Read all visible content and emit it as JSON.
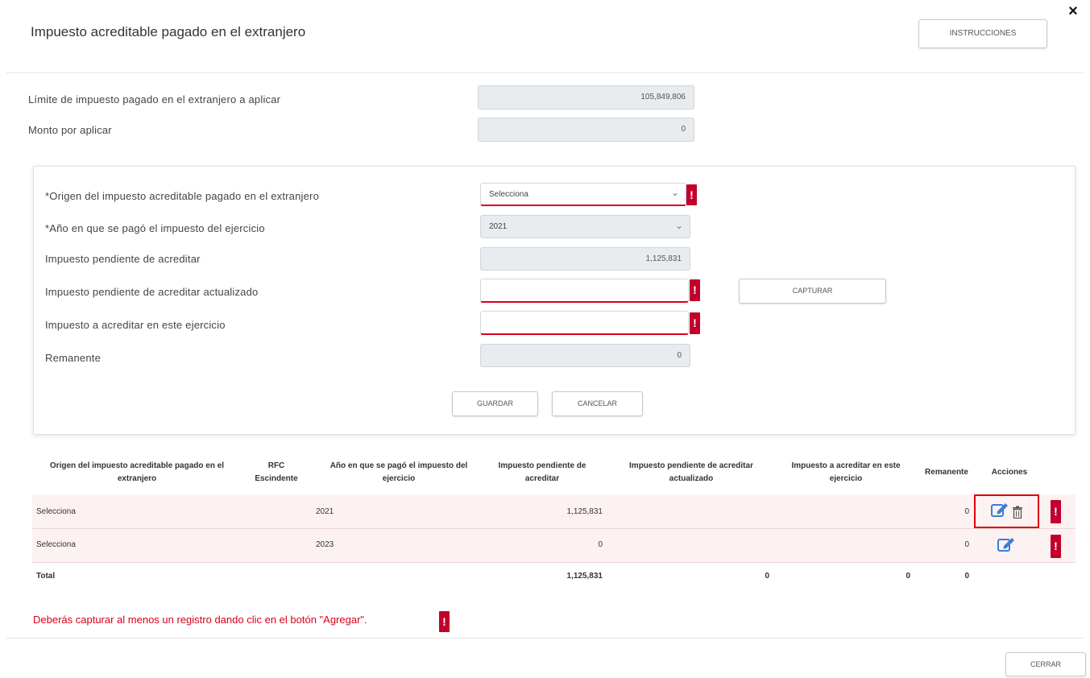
{
  "header": {
    "title": "Impuesto acreditable pagado en el extranjero",
    "instructions_label": "INSTRUCCIONES",
    "close_glyph": "×"
  },
  "summary": {
    "limit_label": "Límite de impuesto pagado en el extranjero a aplicar",
    "limit_value": "105,849,806",
    "pending_label": "Monto por aplicar",
    "pending_value": "0"
  },
  "form": {
    "origin_label": "*Origen del impuesto acreditable pagado en el extranjero",
    "origin_value": "Selecciona",
    "year_label": "*Año en que se pagó el impuesto del ejercicio",
    "year_value": "2021",
    "pending_tax_label": "Impuesto pendiente de acreditar",
    "pending_tax_value": "1,125,831",
    "pending_updated_label": "Impuesto pendiente de acreditar actualizado",
    "pending_updated_value": "",
    "capture_label": "CAPTURAR",
    "to_credit_label": "Impuesto a acreditar en este ejercicio",
    "to_credit_value": "",
    "remainder_label": "Remanente",
    "remainder_value": "0",
    "save_label": "GUARDAR",
    "cancel_label": "CANCELAR",
    "error_glyph": "!"
  },
  "table": {
    "headers": [
      "Origen del impuesto acreditable pagado en el extranjero",
      "RFC Escindente",
      "Año en que se pagó el impuesto del ejercicio",
      "Impuesto pendiente de acreditar",
      "Impuesto pendiente de acreditar actualizado",
      "Impuesto a acreditar en este ejercicio",
      "Remanente",
      "Acciones"
    ],
    "rows": [
      {
        "origin": "Selecciona",
        "rfc": "",
        "year": "2021",
        "pending": "1,125,831",
        "updated": "",
        "credit": "",
        "remainder": "0"
      },
      {
        "origin": "Selecciona",
        "rfc": "",
        "year": "2023",
        "pending": "0",
        "updated": "",
        "credit": "",
        "remainder": "0"
      }
    ],
    "total": {
      "label": "Total",
      "pending": "1,125,831",
      "updated": "0",
      "credit": "0",
      "remainder": "0"
    }
  },
  "footer": {
    "error_message": "Deberás capturar al menos un registro dando clic en el botón \"Agregar\".",
    "close_label": "CERRAR"
  },
  "colors": {
    "error_red": "#d9001b",
    "badge_red": "#c1002b",
    "edit_blue": "#3b7dd8",
    "row_highlight": "#fdf2f2"
  }
}
